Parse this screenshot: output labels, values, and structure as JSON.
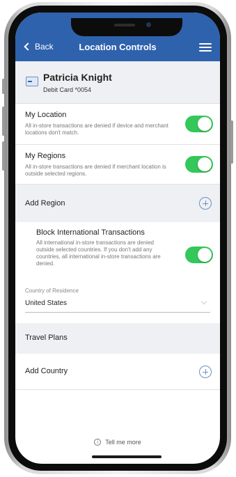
{
  "nav": {
    "back_label": "Back",
    "title": "Location Controls"
  },
  "card": {
    "name": "Patricia Knight",
    "subtitle": "Debit Card *0054"
  },
  "my_location": {
    "title": "My Location",
    "description": "All in-store transactions are denied if device and merchant locations don't match.",
    "enabled": true
  },
  "my_regions": {
    "title": "My Regions",
    "description": "All in-store transactions are denied if merchant location is outside selected regions.",
    "enabled": true
  },
  "add_region": {
    "label": "Add Region"
  },
  "block_international": {
    "title": "Block International Transactions",
    "description": "All international in-store transactions are denied outside selected countries. If you don't add any countries, all international in-store transactions are denied.",
    "enabled": true
  },
  "country_of_residence": {
    "label": "Country of Residence",
    "value": "United States"
  },
  "travel_plans": {
    "label": "Travel Plans"
  },
  "add_country": {
    "label": "Add Country"
  },
  "footer": {
    "tell_me_more": "Tell me more",
    "info_glyph": "i"
  },
  "colors": {
    "nav_blue": "#2f62ad",
    "toggle_green": "#34c759",
    "section_gray": "#eef0f3"
  }
}
